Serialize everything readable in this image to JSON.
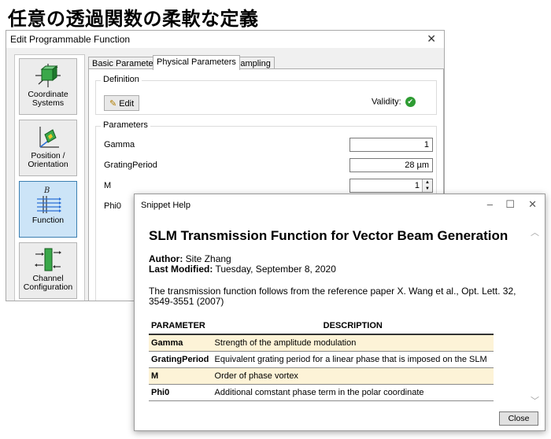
{
  "heading": "任意の透過関数の柔軟な定義",
  "main_dialog": {
    "title": "Edit Programmable Function",
    "close_glyph": "✕",
    "nav": [
      {
        "label_1": "Coordinate",
        "label_2": "Systems"
      },
      {
        "label_1": "Position /",
        "label_2": "Orientation"
      },
      {
        "label_1": "Function",
        "label_2": "",
        "icon_letter": "B"
      },
      {
        "label_1": "Channel",
        "label_2": "Configuration"
      }
    ],
    "tabs": [
      "Basic Parameters",
      "Physical Parameters",
      "Sampling"
    ],
    "definition": {
      "caption": "Definition",
      "edit_label": "Edit",
      "validity_label": "Validity:"
    },
    "parameters": {
      "caption": "Parameters",
      "rows": [
        {
          "name": "Gamma",
          "value": "1"
        },
        {
          "name": "GratingPeriod",
          "value": "28 µm"
        },
        {
          "name": "M",
          "value": "1"
        },
        {
          "name": "Phi0",
          "value": ""
        }
      ]
    }
  },
  "snippet_help": {
    "title": "Snippet Help",
    "doc_title": "SLM Transmission Function for Vector Beam Generation",
    "author_label": "Author:",
    "author": "Site Zhang",
    "modified_label": "Last Modified:",
    "modified": "Tuesday, September 8, 2020",
    "description": "The transmission function follows from the reference paper X. Wang et al., Opt. Lett. 32, 3549-3551 (2007)",
    "table_headers": [
      "PARAMETER",
      "DESCRIPTION"
    ],
    "table_rows": [
      {
        "name": "Gamma",
        "desc": "Strength of the amplitude modulation"
      },
      {
        "name": "GratingPeriod",
        "desc": "Equivalent grating period for a linear phase that is imposed on the SLM"
      },
      {
        "name": "M",
        "desc": "Order of phase vortex"
      },
      {
        "name": "Phi0",
        "desc": "Additional comstant phase term in the polar coordinate"
      }
    ],
    "close_label": "Close"
  },
  "colors": {
    "accent_active_tile": "#cce4f7",
    "table_alt_row": "#fdf3d7",
    "validity_ok": "#2e9c33"
  }
}
